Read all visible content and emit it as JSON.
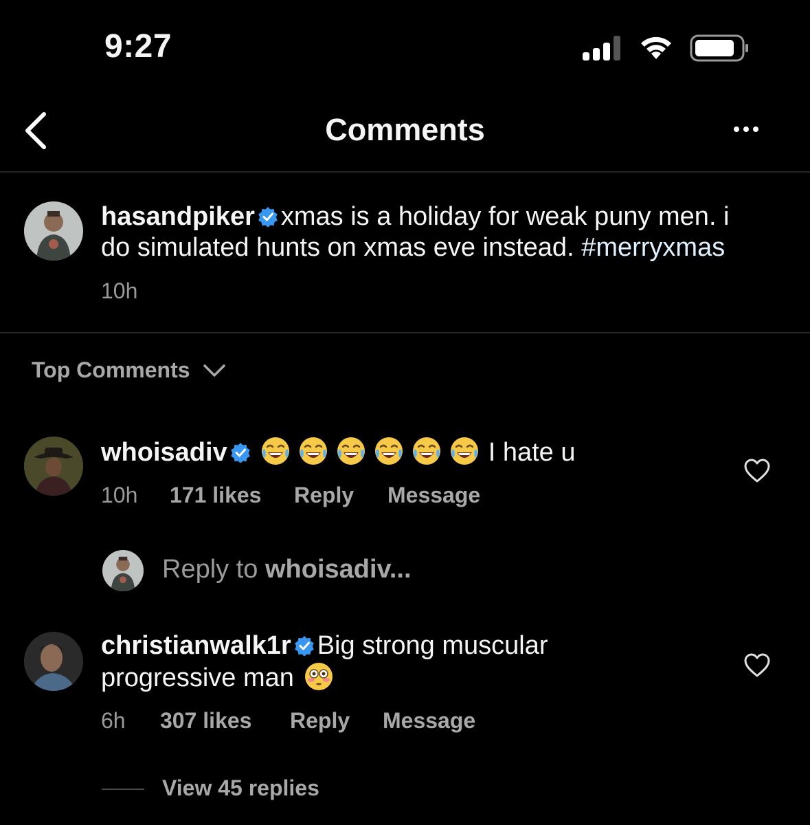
{
  "status_bar": {
    "time": "9:27",
    "icons": [
      "signal-icon",
      "wifi-icon",
      "battery-icon"
    ]
  },
  "header": {
    "title": "Comments",
    "back_icon": "chevron-left-icon",
    "more_icon": "more-horizontal-icon"
  },
  "caption": {
    "username": "hasandpiker",
    "verified": true,
    "text_line1": "xmas is a holiday for weak puny men. i",
    "text_line2": "do simulated hunts on xmas eve instead.",
    "hashtag": "#merryxmas",
    "time": "10h"
  },
  "sort": {
    "label": "Top Comments",
    "icon": "chevron-down-icon"
  },
  "comments": [
    {
      "username": "whoisadiv",
      "verified": true,
      "emoji": "😂😂😂😂😂😂",
      "text": "I hate u",
      "time": "10h",
      "likes": "171 likes",
      "reply": "Reply",
      "message": "Message"
    },
    {
      "username": "christianwalk1r",
      "verified": true,
      "text_line1": "Big strong muscular",
      "text_line2": "progressive man",
      "emoji": "😳",
      "time": "6h",
      "likes": "307 likes",
      "reply": "Reply",
      "message": "Message",
      "view_replies": "View 45 replies"
    }
  ],
  "reply_box": {
    "prefix": "Reply to",
    "username": "whoisadiv..."
  },
  "colors": {
    "background": "#000000",
    "text": "#f5f5f5",
    "muted": "#a8a8a8",
    "verified": "#3897f0",
    "hashtag": "#e0f1ff"
  }
}
